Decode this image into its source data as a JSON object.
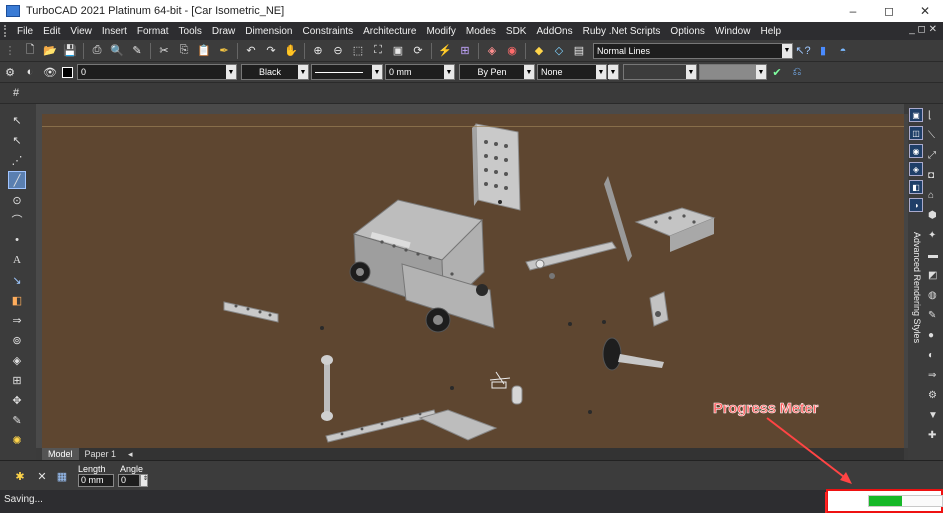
{
  "window": {
    "title": "TurboCAD 2021 Platinum 64-bit - [Car Isometric_NE]",
    "minimize": "–",
    "restore": "◻",
    "close": "✕",
    "mdi_buttons": "_ ◻ ✕"
  },
  "menu": [
    "File",
    "Edit",
    "View",
    "Insert",
    "Format",
    "Tools",
    "Draw",
    "Dimension",
    "Constraints",
    "Architecture",
    "Modify",
    "Modes",
    "SDK",
    "AddOns",
    "Ruby .Net Scripts",
    "Options",
    "Window",
    "Help"
  ],
  "toolbar_standard": {
    "icons": [
      "new-file-icon",
      "open-folder-icon",
      "save-icon",
      "print-icon",
      "print-preview-icon",
      "clear-icon",
      "cut-icon",
      "copy-icon",
      "paste-icon",
      "format-painter-icon",
      "undo-icon",
      "redo-icon",
      "pan-icon",
      "zoom-in-icon",
      "zoom-out-icon",
      "zoom-window-icon",
      "zoom-extents-icon",
      "zoom-page-icon",
      "redraw-icon",
      "snap-icon",
      "grid-icon",
      "layer-icon",
      "render-icon",
      "material-icon",
      "wireframe-icon",
      "print-style-icon"
    ],
    "render_mode": "Normal Lines"
  },
  "toolbar_property": {
    "layer_value": "0",
    "color_value": "Black",
    "line_width_value": "0 mm",
    "pen_value": "By Pen",
    "fill_value": "None"
  },
  "canvas": {
    "background": "#5e4630",
    "tabs": [
      "Model",
      "Paper 1"
    ]
  },
  "adv_panel_label": "Advanced Rendering Styles",
  "inspector": {
    "length_label": "Length",
    "angle_label": "Angle",
    "length_value": "0 mm",
    "angle_value": "0"
  },
  "status": {
    "text": "Saving...",
    "progress": 0.45
  },
  "annotation": {
    "label": "Progress Meter",
    "color": "#ff4d4d"
  }
}
